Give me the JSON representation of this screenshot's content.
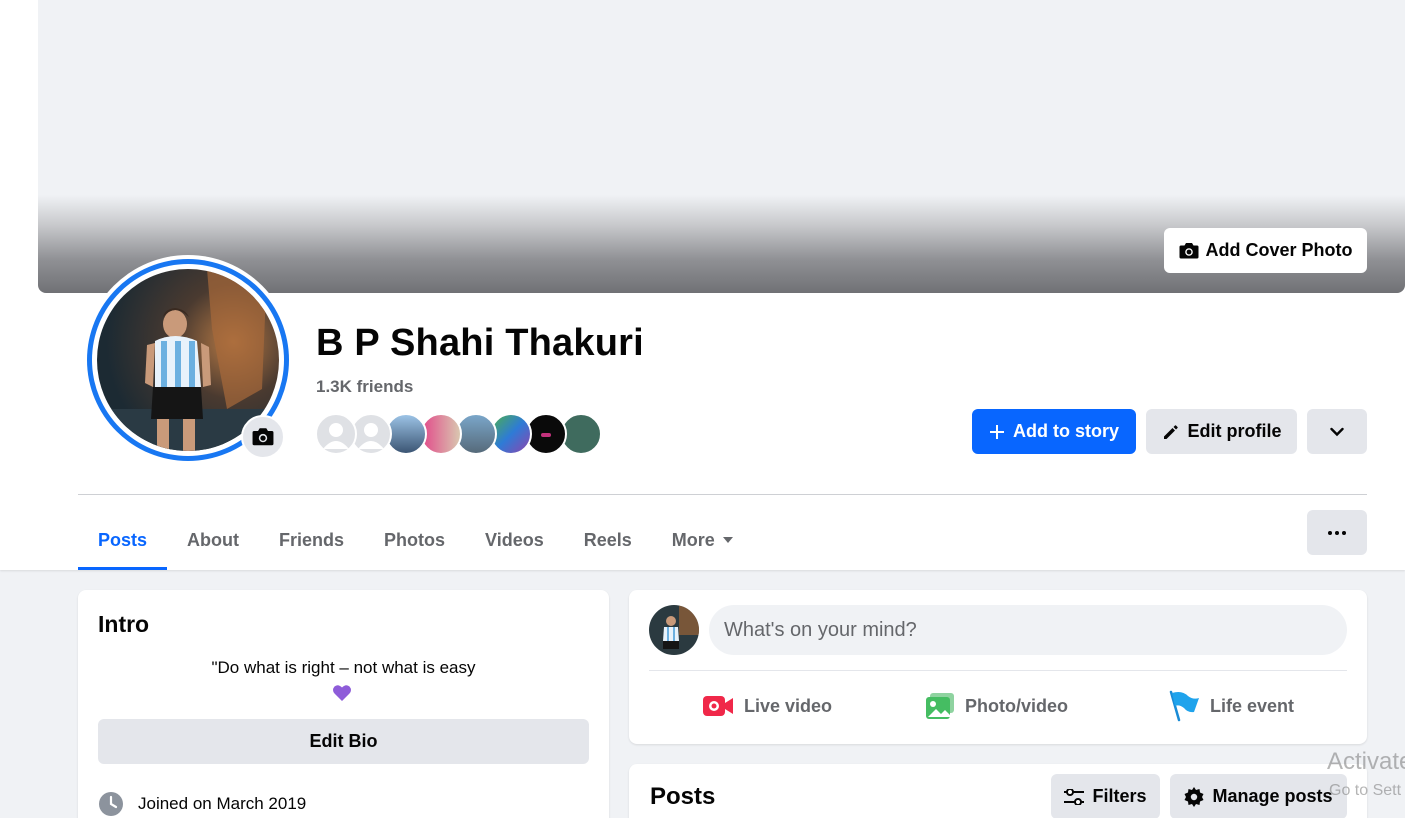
{
  "cover": {
    "add_cover_label": "Add Cover Photo"
  },
  "profile": {
    "name": "B P Shahi Thakuri",
    "friends_count": "1.3K friends"
  },
  "actions": {
    "add_to_story": "Add to story",
    "edit_profile": "Edit profile"
  },
  "tabs": [
    {
      "label": "Posts",
      "active": true
    },
    {
      "label": "About"
    },
    {
      "label": "Friends"
    },
    {
      "label": "Photos"
    },
    {
      "label": "Videos"
    },
    {
      "label": "Reels"
    },
    {
      "label": "More"
    }
  ],
  "intro": {
    "title": "Intro",
    "bio": "\"Do what is right – not what is easy",
    "bio_emoji": "💜",
    "edit_bio_label": "Edit Bio",
    "joined": "Joined on March 2019"
  },
  "composer": {
    "placeholder": "What's on your mind?",
    "live_video": "Live video",
    "photo_video": "Photo/video",
    "life_event": "Life event"
  },
  "posts": {
    "title": "Posts",
    "filters_label": "Filters",
    "manage_label": "Manage posts"
  },
  "watermark": {
    "line1": "Activate",
    "line2": "Go to Sett"
  },
  "colors": {
    "primary": "#0866ff",
    "button_gray": "#e4e6eb",
    "bg": "#f0f2f5",
    "secondary_text": "#65676b"
  }
}
